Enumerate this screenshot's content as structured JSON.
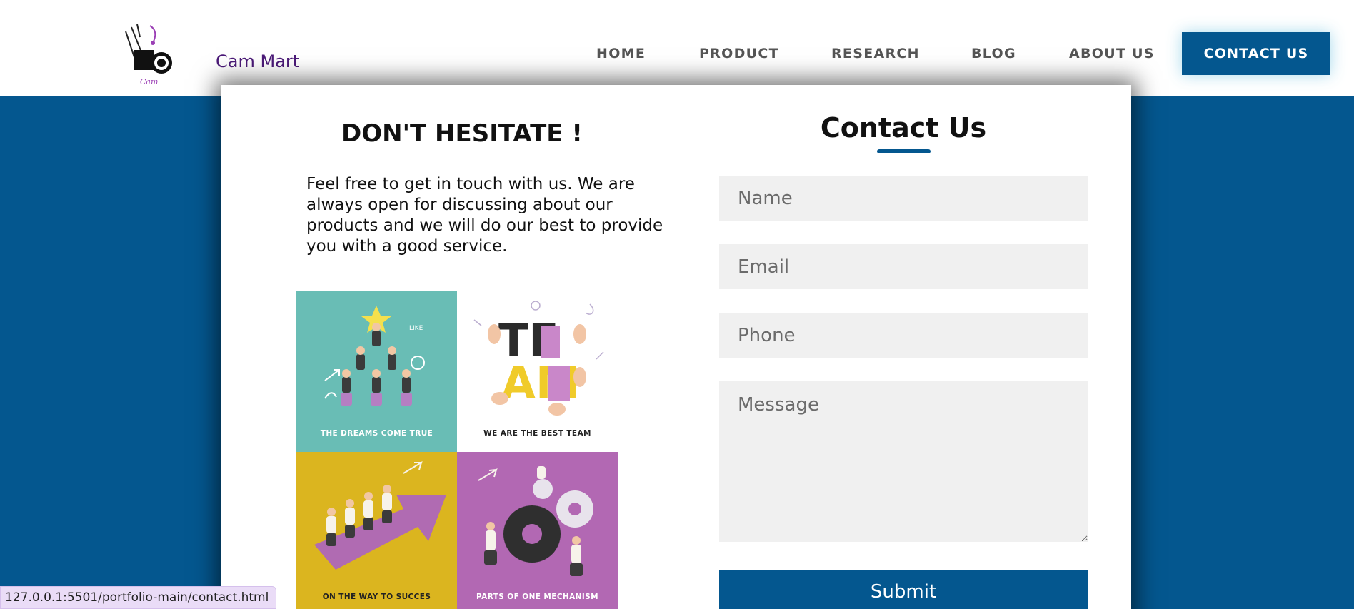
{
  "brand": {
    "name": "Cam Mart",
    "logo_icon": "camera-logo-icon",
    "logo_text": "Cam"
  },
  "nav": {
    "items": [
      {
        "label": "HOME"
      },
      {
        "label": "PRODUCT"
      },
      {
        "label": "RESEARCH"
      },
      {
        "label": "BLOG"
      },
      {
        "label": "ABOUT US"
      }
    ],
    "cta_label": "CONTACT US"
  },
  "intro": {
    "title": "DON'T HESITATE !",
    "text": "Feel free to get in touch with us. We are always open for discussing about our products and we will do our best to provide you with a good service."
  },
  "tiles": [
    {
      "caption": "THE DREAMS COME TRUE",
      "bg": "#69bdb5"
    },
    {
      "caption": "WE ARE THE BEST TEAM",
      "bg": "#ffffff",
      "word_top": "TE",
      "word_bottom": "AM"
    },
    {
      "caption": "ON THE WAY TO SUCCES",
      "bg": "#dbb51f"
    },
    {
      "caption": "PARTS OF ONE MECHANISM",
      "bg": "#b268b3"
    }
  ],
  "form": {
    "title": "Contact Us",
    "name_placeholder": "Name",
    "email_placeholder": "Email",
    "phone_placeholder": "Phone",
    "message_placeholder": "Message",
    "submit_label": "Submit"
  },
  "status_bar": {
    "url": "127.0.0.1:5501/portfolio-main/contact.html"
  },
  "colors": {
    "accent": "#04578f",
    "brand_text": "#4b1a78",
    "field_bg": "#f0f0f0"
  }
}
